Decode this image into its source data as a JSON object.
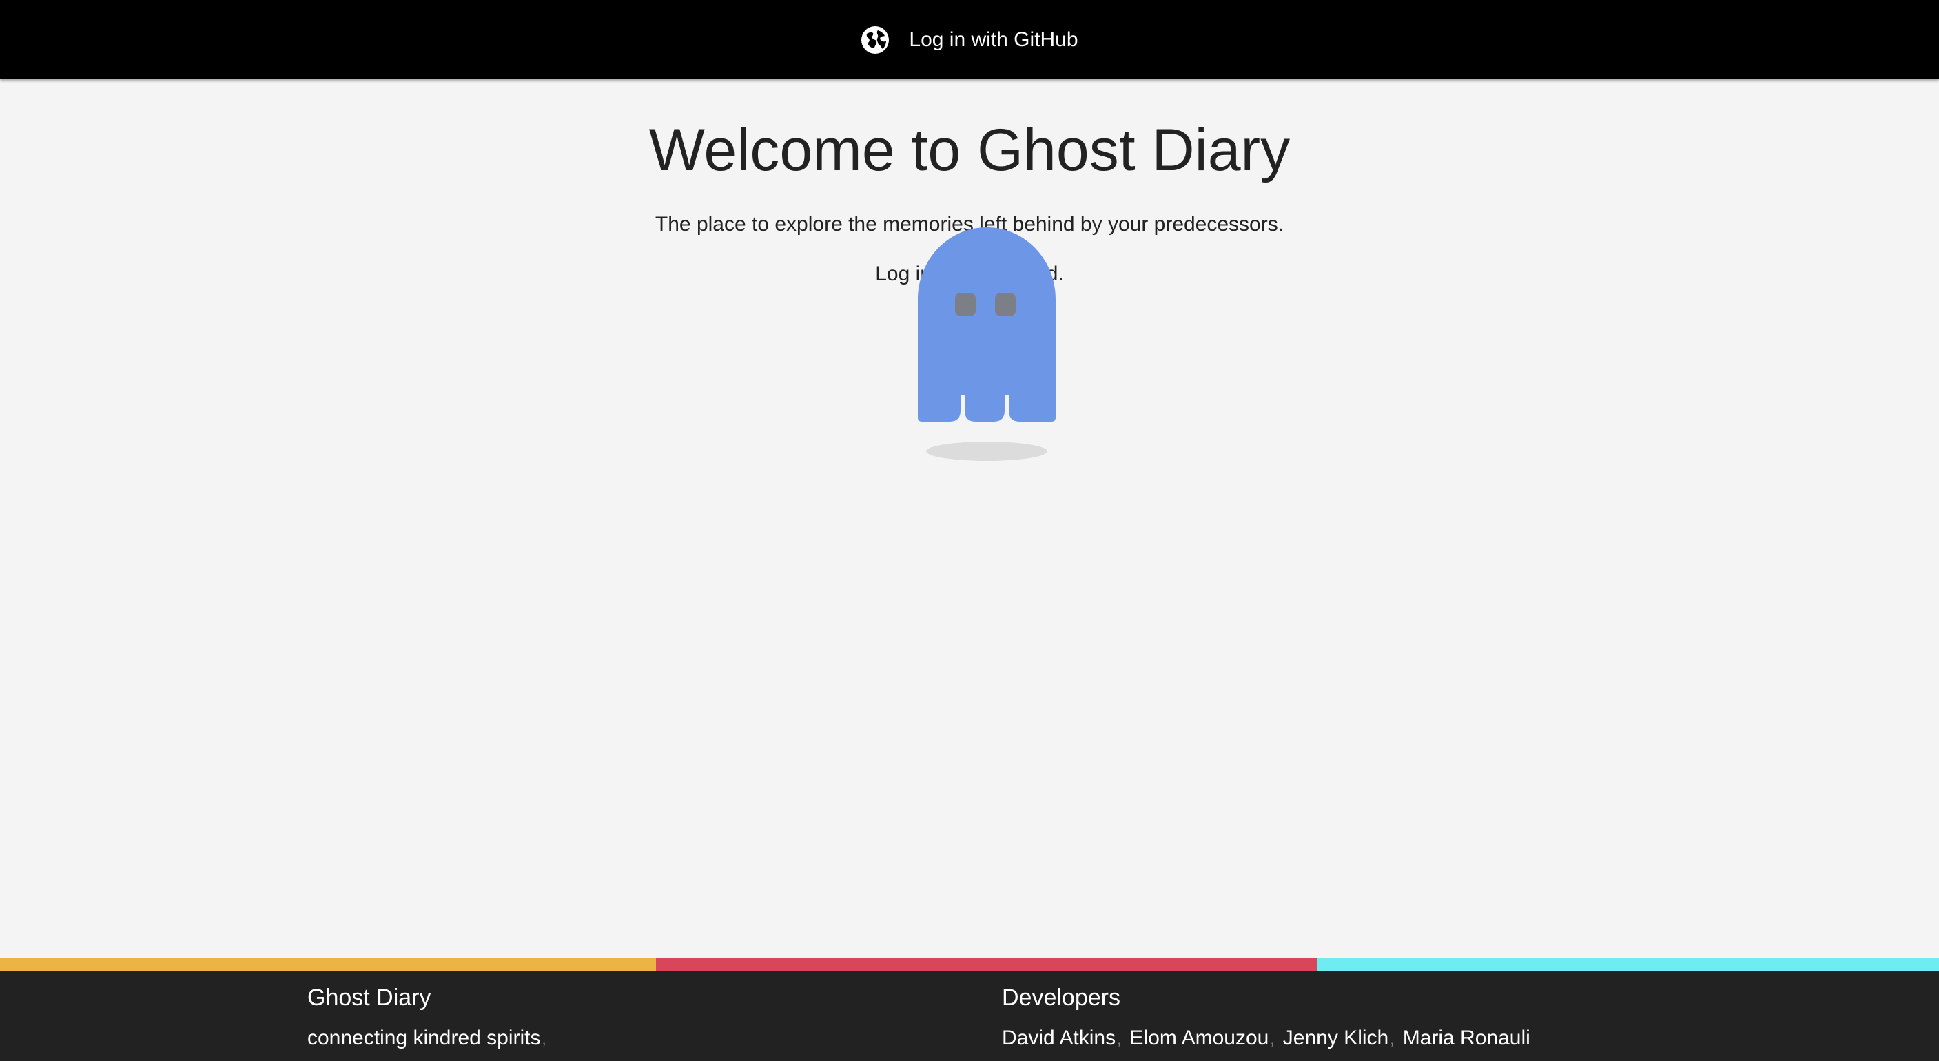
{
  "header": {
    "login_label": "Log in with GitHub",
    "login_icon": "globe-icon"
  },
  "main": {
    "title": "Welcome to Ghost Diary",
    "tagline": "The place to explore the memories left behind by your predecessors.",
    "cta": "Log in to get started.",
    "mascot_icon": "ghost-icon",
    "ghost_color": "#6d97e6"
  },
  "strip_colors": [
    "#ecb345",
    "#d9465a",
    "#6fecf2"
  ],
  "footer": {
    "brand": {
      "title": "Ghost Diary",
      "slogan": "connecting kindred spirits",
      "slogan_suffix": ","
    },
    "developers": {
      "title": "Developers",
      "names": [
        "David Atkins",
        "Elom Amouzou",
        "Jenny Klich",
        "Maria Ronauli"
      ],
      "separator": ","
    }
  }
}
